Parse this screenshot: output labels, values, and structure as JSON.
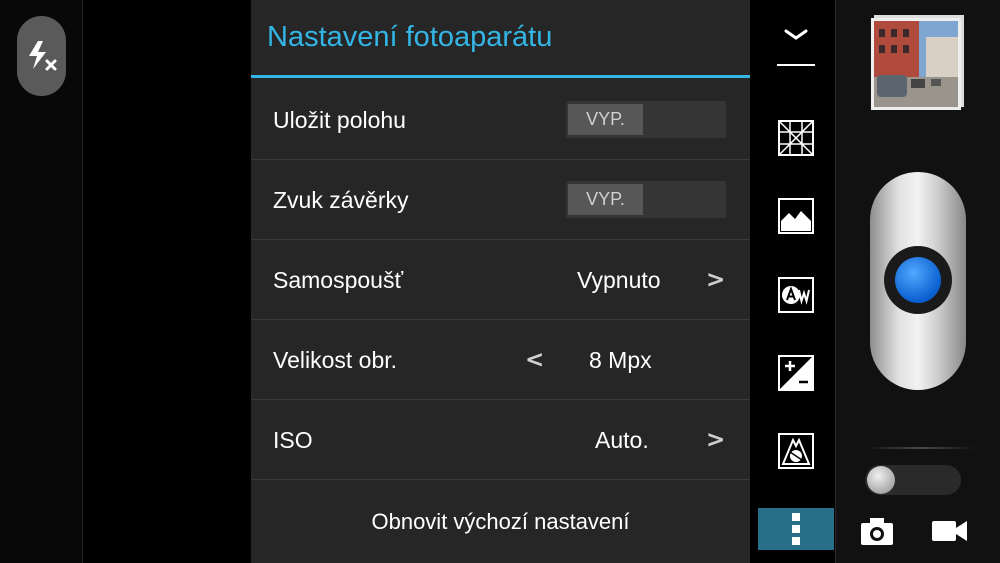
{
  "settings_panel": {
    "title": "Nastavení fotoaparátu",
    "rows": [
      {
        "label": "Uložit polohu",
        "toggle": "VYP."
      },
      {
        "label": "Zvuk závěrky",
        "toggle": "VYP."
      },
      {
        "label": "Samospoušť",
        "value": "Vypnuto",
        "next": ">"
      },
      {
        "label": "Velikost obr.",
        "prev": "<",
        "value": "8 Mpx"
      },
      {
        "label": "ISO",
        "value": "Auto.",
        "next": ">"
      }
    ],
    "reset_label": "Obnovit výchozí nastavení"
  },
  "icons": {
    "flash": "flash-off-icon",
    "collapse": "chevron-down-icon",
    "grid": "grid-icon",
    "scene": "landscape-icon",
    "white_balance": "white-balance-auto-icon",
    "exposure": "exposure-icon",
    "effects": "color-effect-icon",
    "more": "more-vertical-icon",
    "camera": "camera-icon",
    "video": "video-icon"
  },
  "colors": {
    "accent": "#33b5e5",
    "panel_bg": "#262626",
    "selected_tab": "#276f88",
    "shutter_dot": "#1a73e8"
  }
}
